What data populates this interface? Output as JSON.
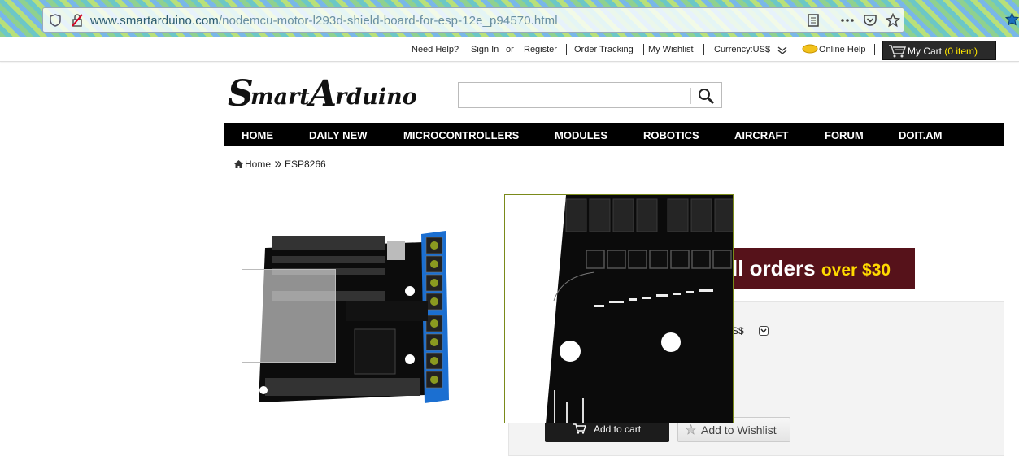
{
  "browser": {
    "url_domain": "www.smartarduino.com",
    "url_path": "/nodemcu-motor-l293d-shield-board-for-esp-12e_p94570.html",
    "icons": [
      "shield-icon",
      "insecure-lock-icon",
      "reader-view-icon",
      "more-icon",
      "pocket-icon",
      "bookmark-star-icon",
      "extension-icon"
    ]
  },
  "topbar": {
    "need_help": "Need Help?",
    "sign_in": "Sign In",
    "or": "or",
    "register": "Register",
    "order_tracking": "Order Tracking",
    "wishlist": "My Wishlist",
    "currency": "Currency:US$",
    "online_help": "Online Help",
    "cart_label": "My Cart",
    "cart_count": "(0  item)"
  },
  "logo": {
    "text": "SmartArduino"
  },
  "search": {
    "placeholder": "",
    "value": ""
  },
  "nav": {
    "items": [
      "HOME",
      "DAILY NEW",
      "MICROCONTROLLERS",
      "MODULES",
      "ROBOTICS",
      "AIRCRAFT",
      "FORUM",
      "DOIT.AM"
    ]
  },
  "breadcrumb": {
    "home": "Home",
    "current": "ESP8266"
  },
  "promo": {
    "text_main": "ll orders",
    "text_highlight": "over $30"
  },
  "options": {
    "currency_fragment": "S$"
  },
  "buttons": {
    "add_to_cart": "Add to cart",
    "add_to_wishlist": "Add to Wishlist"
  },
  "colors": {
    "nav_bg": "#000000",
    "promo_bg": "#56121a",
    "promo_highlight": "#ffd900",
    "cart_count": "#ffe600"
  }
}
